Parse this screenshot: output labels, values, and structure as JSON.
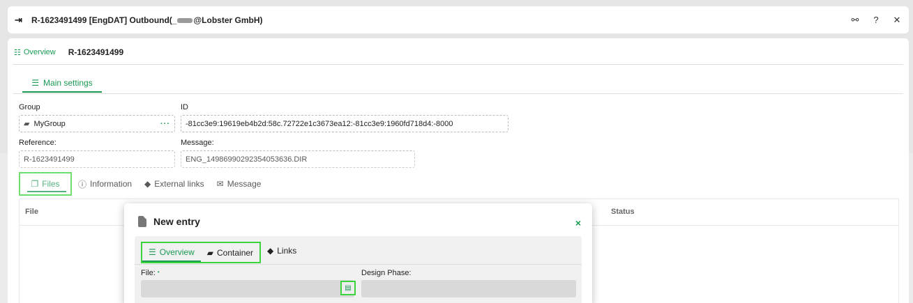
{
  "window": {
    "title_prefix": "R-1623491499 [EngDAT] Outbound(_",
    "title_suffix": "@Lobster GmbH)",
    "icons": [
      "exit-icon",
      "share-icon",
      "help-icon",
      "close-icon"
    ],
    "help_glyph": "?",
    "close_glyph": "✕"
  },
  "breadcrumb": {
    "overview_label": "Overview",
    "record_label": "R-1623491499"
  },
  "main_tab": {
    "label": "Main settings"
  },
  "form": {
    "group_label": "Group",
    "group_value": "MyGroup",
    "group_more": "···",
    "id_label": "ID",
    "id_value": "-81cc3e9:19619eb4b2d:58c.72722e1c3673ea12:-81cc3e9:1960fd718d4:-8000",
    "reference_label": "Reference:",
    "reference_value": "R-1623491499",
    "message_label": "Message:",
    "message_value": "ENG_14986990292354053636.DIR"
  },
  "subtabs": [
    {
      "label": "Files",
      "active": true
    },
    {
      "label": "Information"
    },
    {
      "label": "External links"
    },
    {
      "label": "Message"
    }
  ],
  "grid": {
    "columns": [
      "File",
      "Status"
    ]
  },
  "modal": {
    "title": "New entry",
    "close_glyph": "×",
    "tabs": [
      {
        "label": "Overview",
        "active": true
      },
      {
        "label": "Container"
      }
    ],
    "links_label": "Links",
    "file_label": "File:",
    "required_mark": "•",
    "design_phase_label": "Design Phase:"
  },
  "colors": {
    "accent": "#1a9a53",
    "highlight": "#3cd43c"
  }
}
